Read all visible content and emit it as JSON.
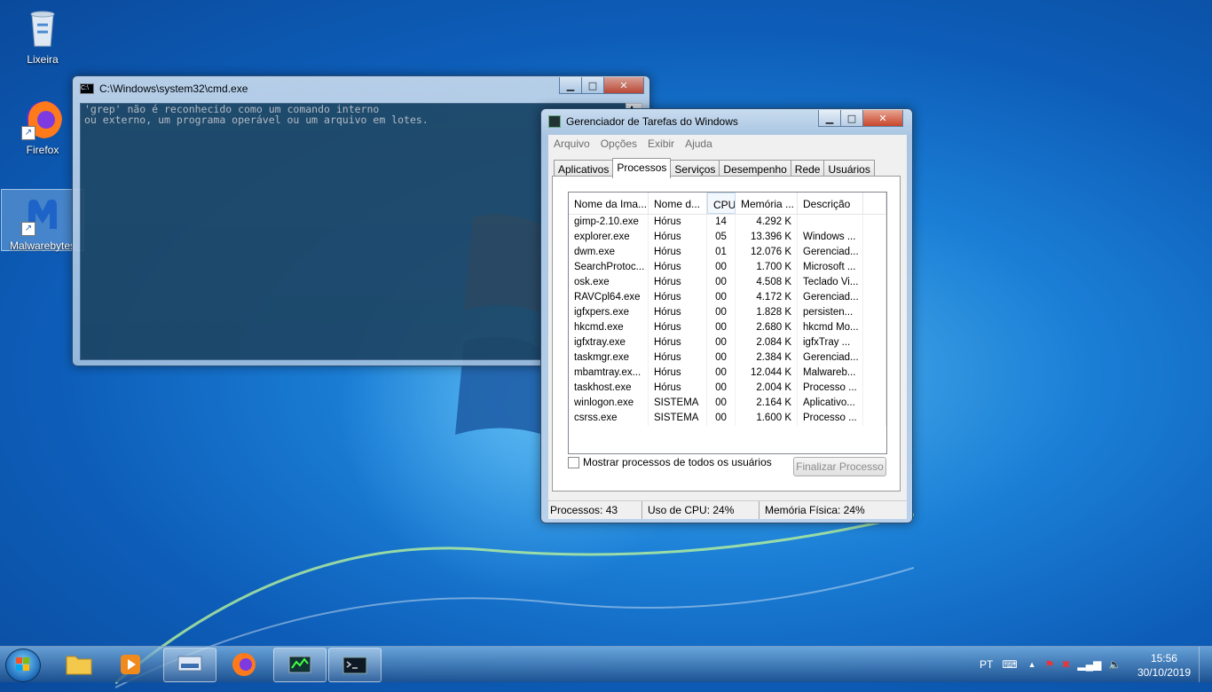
{
  "desktop": {
    "icons": [
      {
        "label": "Lixeira"
      },
      {
        "label": "Firefox"
      },
      {
        "label": "Malwarebytes"
      }
    ]
  },
  "cmd": {
    "title": "C:\\Windows\\system32\\cmd.exe",
    "output": "'grep' não é reconhecido como um comando interno\nou externo, um programa operável ou um arquivo em lotes."
  },
  "taskmgr": {
    "title": "Gerenciador de Tarefas do Windows",
    "menu": [
      "Arquivo",
      "Opções",
      "Exibir",
      "Ajuda"
    ],
    "tabs": [
      "Aplicativos",
      "Processos",
      "Serviços",
      "Desempenho",
      "Rede",
      "Usuários"
    ],
    "active_tab": "Processos",
    "columns": [
      "Nome da Ima...",
      "Nome d...",
      "CPU",
      "Memória ...",
      "Descrição"
    ],
    "sorted_column": "CPU",
    "rows": [
      [
        "gimp-2.10.exe",
        "Hórus",
        "14",
        "4.292 K",
        ""
      ],
      [
        "explorer.exe",
        "Hórus",
        "05",
        "13.396 K",
        "Windows ..."
      ],
      [
        "dwm.exe",
        "Hórus",
        "01",
        "12.076 K",
        "Gerenciad..."
      ],
      [
        "SearchProtoc...",
        "Hórus",
        "00",
        "1.700 K",
        "Microsoft ..."
      ],
      [
        "osk.exe",
        "Hórus",
        "00",
        "4.508 K",
        "Teclado Vi..."
      ],
      [
        "RAVCpl64.exe",
        "Hórus",
        "00",
        "4.172 K",
        "Gerenciad..."
      ],
      [
        "igfxpers.exe",
        "Hórus",
        "00",
        "1.828 K",
        "persisten..."
      ],
      [
        "hkcmd.exe",
        "Hórus",
        "00",
        "2.680 K",
        "hkcmd Mo..."
      ],
      [
        "igfxtray.exe",
        "Hórus",
        "00",
        "2.084 K",
        "igfxTray ..."
      ],
      [
        "taskmgr.exe",
        "Hórus",
        "00",
        "2.384 K",
        "Gerenciad..."
      ],
      [
        "mbamtray.ex...",
        "Hórus",
        "00",
        "12.044 K",
        "Malwareb..."
      ],
      [
        "taskhost.exe",
        "Hórus",
        "00",
        "2.004 K",
        "Processo ..."
      ],
      [
        "winlogon.exe",
        "SISTEMA",
        "00",
        "2.164 K",
        "Aplicativo..."
      ],
      [
        "csrss.exe",
        "SISTEMA",
        "00",
        "1.600 K",
        "Processo ..."
      ]
    ],
    "show_all_label": "Mostrar processos de todos os usuários",
    "end_process_label": "Finalizar Processo",
    "status": {
      "processes": "Processos: 43",
      "cpu": "Uso de CPU: 24%",
      "memory": "Memória Física: 24%"
    }
  },
  "taskbar": {
    "language": "PT",
    "time": "15:56",
    "date": "30/10/2019"
  }
}
